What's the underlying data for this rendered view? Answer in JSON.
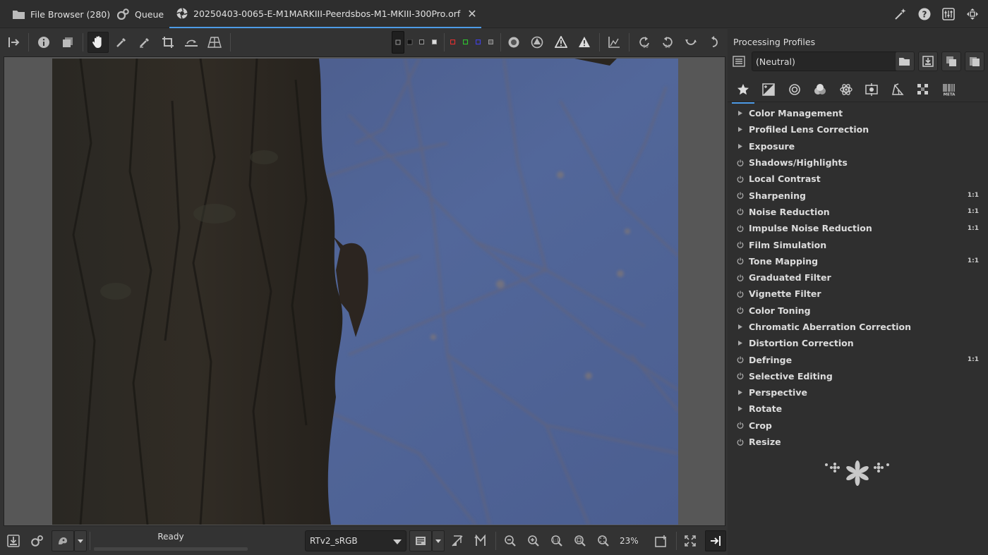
{
  "tabs": [
    {
      "label": "File Browser (280)",
      "icon": "folder-icon"
    },
    {
      "label": "Queue",
      "icon": "gears-icon"
    },
    {
      "label": "20250403-0065-E-M1MARKIII-Peerdsbos-M1-MKIII-300Pro.orf",
      "icon": "aperture-icon",
      "active": true
    }
  ],
  "bottom": {
    "status": "Ready",
    "output_profile": "RTv2_sRGB",
    "zoom": "23%",
    "progress": 0
  },
  "profiles": {
    "title": "Processing Profiles",
    "selected": "(Neutral)"
  },
  "tools": [
    {
      "name": "Color Management",
      "type": "expander"
    },
    {
      "name": "Profiled Lens Correction",
      "type": "expander"
    },
    {
      "name": "Exposure",
      "type": "expander"
    },
    {
      "name": "Shadows/Highlights",
      "type": "power"
    },
    {
      "name": "Local Contrast",
      "type": "power"
    },
    {
      "name": "Sharpening",
      "type": "power",
      "badge": "1:1"
    },
    {
      "name": "Noise Reduction",
      "type": "power",
      "badge": "1:1"
    },
    {
      "name": "Impulse Noise Reduction",
      "type": "power",
      "badge": "1:1"
    },
    {
      "name": "Film Simulation",
      "type": "power"
    },
    {
      "name": "Tone Mapping",
      "type": "power",
      "badge": "1:1"
    },
    {
      "name": "Graduated Filter",
      "type": "power"
    },
    {
      "name": "Vignette Filter",
      "type": "power"
    },
    {
      "name": "Color Toning",
      "type": "power"
    },
    {
      "name": "Chromatic Aberration Correction",
      "type": "expander"
    },
    {
      "name": "Distortion Correction",
      "type": "expander"
    },
    {
      "name": "Defringe",
      "type": "power",
      "badge": "1:1"
    },
    {
      "name": "Selective Editing",
      "type": "power"
    },
    {
      "name": "Perspective",
      "type": "expander"
    },
    {
      "name": "Rotate",
      "type": "expander"
    },
    {
      "name": "Crop",
      "type": "power"
    },
    {
      "name": "Resize",
      "type": "power"
    }
  ],
  "colors": {
    "accent": "#4d9be6",
    "sky": "#4a5e8e",
    "trunk": "#2a2622"
  }
}
